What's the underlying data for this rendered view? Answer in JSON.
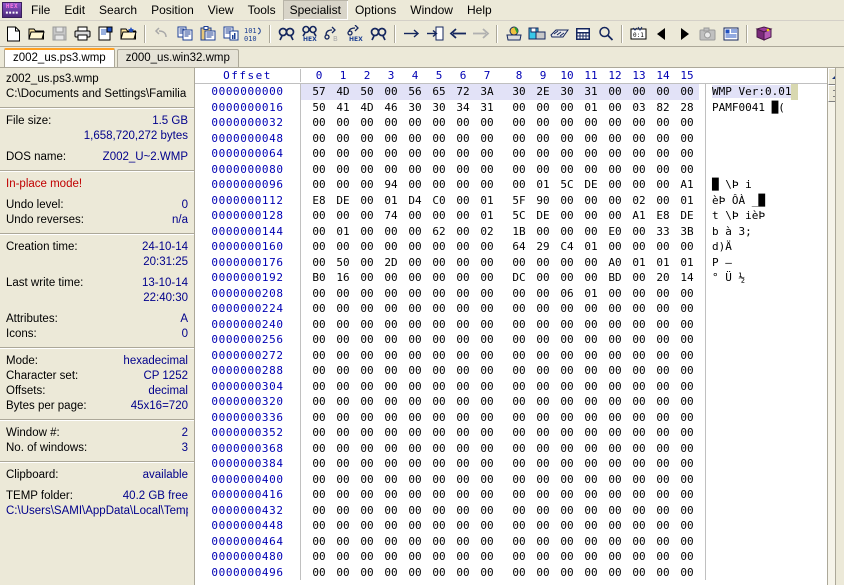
{
  "app": {
    "logo_top": "HEX",
    "logo_bottom": "Editor"
  },
  "menu": {
    "items": [
      {
        "label": "File",
        "active": false
      },
      {
        "label": "Edit",
        "active": false
      },
      {
        "label": "Search",
        "active": false
      },
      {
        "label": "Position",
        "active": false
      },
      {
        "label": "View",
        "active": false
      },
      {
        "label": "Tools",
        "active": false
      },
      {
        "label": "Specialist",
        "active": true
      },
      {
        "label": "Options",
        "active": false
      },
      {
        "label": "Window",
        "active": false
      },
      {
        "label": "Help",
        "active": false
      }
    ]
  },
  "toolbar": {
    "buttons": [
      {
        "icon": "new-file-icon",
        "enabled": true
      },
      {
        "icon": "open-folder-icon",
        "enabled": true
      },
      {
        "icon": "save-icon",
        "enabled": false
      },
      {
        "icon": "print-icon",
        "enabled": true
      },
      {
        "icon": "file-properties-icon",
        "enabled": true
      },
      {
        "icon": "open-folder-star-icon",
        "enabled": true
      },
      {
        "icon": "separator",
        "enabled": false
      },
      {
        "icon": "undo-icon",
        "enabled": false
      },
      {
        "icon": "copy-icon",
        "enabled": true
      },
      {
        "icon": "paste-icon",
        "enabled": true
      },
      {
        "icon": "clipboard-data-icon",
        "enabled": true
      },
      {
        "icon": "binary-101-icon",
        "enabled": true
      },
      {
        "icon": "separator",
        "enabled": false
      },
      {
        "icon": "find-text-icon",
        "enabled": true
      },
      {
        "icon": "find-hex-icon",
        "enabled": true
      },
      {
        "icon": "replace-text-icon",
        "enabled": true
      },
      {
        "icon": "replace-hex-icon",
        "enabled": true
      },
      {
        "icon": "find-again-icon",
        "enabled": true
      },
      {
        "icon": "separator",
        "enabled": false
      },
      {
        "icon": "goto-offset-icon",
        "enabled": true
      },
      {
        "icon": "goto-marker-icon",
        "enabled": true
      },
      {
        "icon": "back-arrow-icon",
        "enabled": true
      },
      {
        "icon": "forward-arrow-icon",
        "enabled": false
      },
      {
        "icon": "separator",
        "enabled": false
      },
      {
        "icon": "open-disk-icon",
        "enabled": true
      },
      {
        "icon": "open-drive-icon",
        "enabled": true
      },
      {
        "icon": "open-ram-icon",
        "enabled": true
      },
      {
        "icon": "calculator-icon",
        "enabled": true
      },
      {
        "icon": "analyze-icon",
        "enabled": true
      },
      {
        "icon": "separator",
        "enabled": false
      },
      {
        "icon": "calc-converter-icon",
        "enabled": true
      },
      {
        "icon": "prev-page-icon",
        "enabled": true
      },
      {
        "icon": "next-page-icon",
        "enabled": true
      },
      {
        "icon": "snapshot-icon",
        "enabled": false
      },
      {
        "icon": "report-icon",
        "enabled": true
      },
      {
        "icon": "separator",
        "enabled": false
      },
      {
        "icon": "help-book-icon",
        "enabled": true
      }
    ]
  },
  "tabs": [
    {
      "label": "z002_us.ps3.wmp",
      "active": true
    },
    {
      "label": "z000_us.win32.wmp",
      "active": false
    }
  ],
  "info_pane": {
    "file_name": "z002_us.ps3.wmp",
    "file_path": "C:\\Documents and Settings\\Familia Riv",
    "file_size_label": "File size:",
    "file_size_value": "1.5 GB",
    "file_size_bytes": "1,658,720,272 bytes",
    "dos_name_label": "DOS name:",
    "dos_name_value": "Z002_U~2.WMP",
    "mode_alert": "In-place mode!",
    "undo_level_label": "Undo level:",
    "undo_level_value": "0",
    "undo_reverses_label": "Undo reverses:",
    "undo_reverses_value": "n/a",
    "creation_time_label": "Creation time:",
    "creation_date_value": "24-10-14",
    "creation_clock_value": "20:31:25",
    "last_write_label": "Last write time:",
    "last_write_date_value": "13-10-14",
    "last_write_clock_value": "22:40:30",
    "attributes_label": "Attributes:",
    "attributes_value": "A",
    "icons_label": "Icons:",
    "icons_value": "0",
    "mode_label": "Mode:",
    "mode_value": "hexadecimal",
    "charset_label": "Character set:",
    "charset_value": "CP 1252",
    "offsets_label": "Offsets:",
    "offsets_value": "decimal",
    "bytes_per_page_label": "Bytes per page:",
    "bytes_per_page_value": "45x16=720",
    "window_num_label": "Window #:",
    "window_num_value": "2",
    "num_windows_label": "No. of windows:",
    "num_windows_value": "3",
    "clipboard_label": "Clipboard:",
    "clipboard_value": "available",
    "temp_folder_label": "TEMP folder:",
    "temp_folder_value": "40.2 GB free",
    "temp_folder_path": "C:\\Users\\SAMI\\AppData\\Local\\Temp"
  },
  "hex_view": {
    "offset_header": "Offset",
    "column_headers": [
      "0",
      "1",
      "2",
      "3",
      "4",
      "5",
      "6",
      "7",
      "8",
      "9",
      "10",
      "11",
      "12",
      "13",
      "14",
      "15"
    ],
    "rows": [
      {
        "offset": "0000000000",
        "bytes": [
          "57",
          "4D",
          "50",
          "00",
          "56",
          "65",
          "72",
          "3A",
          "30",
          "2E",
          "30",
          "31",
          "00",
          "00",
          "00",
          "00"
        ],
        "ascii": "WMP Ver:0.01",
        "selected": true,
        "caret": true
      },
      {
        "offset": "0000000016",
        "bytes": [
          "50",
          "41",
          "4D",
          "46",
          "30",
          "30",
          "34",
          "31",
          "00",
          "00",
          "00",
          "01",
          "00",
          "03",
          "82",
          "28"
        ],
        "ascii": "PAMF0041     █(",
        "selected": false,
        "caret": false
      },
      {
        "offset": "0000000032",
        "bytes": [
          "00",
          "00",
          "00",
          "00",
          "00",
          "00",
          "00",
          "00",
          "00",
          "00",
          "00",
          "00",
          "00",
          "00",
          "00",
          "00"
        ],
        "ascii": "",
        "selected": false,
        "caret": false
      },
      {
        "offset": "0000000048",
        "bytes": [
          "00",
          "00",
          "00",
          "00",
          "00",
          "00",
          "00",
          "00",
          "00",
          "00",
          "00",
          "00",
          "00",
          "00",
          "00",
          "00"
        ],
        "ascii": "",
        "selected": false,
        "caret": false
      },
      {
        "offset": "0000000064",
        "bytes": [
          "00",
          "00",
          "00",
          "00",
          "00",
          "00",
          "00",
          "00",
          "00",
          "00",
          "00",
          "00",
          "00",
          "00",
          "00",
          "00"
        ],
        "ascii": "",
        "selected": false,
        "caret": false
      },
      {
        "offset": "0000000080",
        "bytes": [
          "00",
          "00",
          "00",
          "00",
          "00",
          "00",
          "00",
          "00",
          "00",
          "00",
          "00",
          "00",
          "00",
          "00",
          "00",
          "00"
        ],
        "ascii": "",
        "selected": false,
        "caret": false
      },
      {
        "offset": "0000000096",
        "bytes": [
          "00",
          "00",
          "00",
          "94",
          "00",
          "00",
          "00",
          "00",
          "00",
          "01",
          "5C",
          "DE",
          "00",
          "00",
          "00",
          "A1"
        ],
        "ascii": "   █       \\Þ   i",
        "selected": false,
        "caret": false
      },
      {
        "offset": "0000000112",
        "bytes": [
          "E8",
          "DE",
          "00",
          "01",
          "D4",
          "C0",
          "00",
          "01",
          "5F",
          "90",
          "00",
          "00",
          "00",
          "02",
          "00",
          "01"
        ],
        "ascii": "èÞ  ÔÀ  _█",
        "selected": false,
        "caret": false
      },
      {
        "offset": "0000000128",
        "bytes": [
          "00",
          "00",
          "00",
          "74",
          "00",
          "00",
          "00",
          "01",
          "5C",
          "DE",
          "00",
          "00",
          "00",
          "A1",
          "E8",
          "DE"
        ],
        "ascii": "   t    \\Þ   ièÞ",
        "selected": false,
        "caret": false
      },
      {
        "offset": "0000000144",
        "bytes": [
          "00",
          "01",
          "00",
          "00",
          "00",
          "62",
          "00",
          "02",
          "1B",
          "00",
          "00",
          "00",
          "E0",
          "00",
          "33",
          "3B"
        ],
        "ascii": "     b      à 3;",
        "selected": false,
        "caret": false
      },
      {
        "offset": "0000000160",
        "bytes": [
          "00",
          "00",
          "00",
          "00",
          "00",
          "00",
          "00",
          "00",
          "64",
          "29",
          "C4",
          "01",
          "00",
          "00",
          "00",
          "00"
        ],
        "ascii": "        d)Ä",
        "selected": false,
        "caret": false
      },
      {
        "offset": "0000000176",
        "bytes": [
          "00",
          "50",
          "00",
          "2D",
          "00",
          "00",
          "00",
          "00",
          "00",
          "00",
          "00",
          "00",
          "A0",
          "01",
          "01",
          "01"
        ],
        "ascii": " P –",
        "selected": false,
        "caret": false
      },
      {
        "offset": "0000000192",
        "bytes": [
          "B0",
          "16",
          "00",
          "00",
          "00",
          "00",
          "00",
          "00",
          "DC",
          "00",
          "00",
          "00",
          "BD",
          "00",
          "20",
          "14"
        ],
        "ascii": "°       Ü   ½",
        "selected": false,
        "caret": false
      },
      {
        "offset": "0000000208",
        "bytes": [
          "00",
          "00",
          "00",
          "00",
          "00",
          "00",
          "00",
          "00",
          "00",
          "00",
          "06",
          "01",
          "00",
          "00",
          "00",
          "00"
        ],
        "ascii": "",
        "selected": false,
        "caret": false
      },
      {
        "offset": "0000000224",
        "bytes": [
          "00",
          "00",
          "00",
          "00",
          "00",
          "00",
          "00",
          "00",
          "00",
          "00",
          "00",
          "00",
          "00",
          "00",
          "00",
          "00"
        ],
        "ascii": "",
        "selected": false,
        "caret": false
      },
      {
        "offset": "0000000240",
        "bytes": [
          "00",
          "00",
          "00",
          "00",
          "00",
          "00",
          "00",
          "00",
          "00",
          "00",
          "00",
          "00",
          "00",
          "00",
          "00",
          "00"
        ],
        "ascii": "",
        "selected": false,
        "caret": false
      },
      {
        "offset": "0000000256",
        "bytes": [
          "00",
          "00",
          "00",
          "00",
          "00",
          "00",
          "00",
          "00",
          "00",
          "00",
          "00",
          "00",
          "00",
          "00",
          "00",
          "00"
        ],
        "ascii": "",
        "selected": false,
        "caret": false
      },
      {
        "offset": "0000000272",
        "bytes": [
          "00",
          "00",
          "00",
          "00",
          "00",
          "00",
          "00",
          "00",
          "00",
          "00",
          "00",
          "00",
          "00",
          "00",
          "00",
          "00"
        ],
        "ascii": "",
        "selected": false,
        "caret": false
      },
      {
        "offset": "0000000288",
        "bytes": [
          "00",
          "00",
          "00",
          "00",
          "00",
          "00",
          "00",
          "00",
          "00",
          "00",
          "00",
          "00",
          "00",
          "00",
          "00",
          "00"
        ],
        "ascii": "",
        "selected": false,
        "caret": false
      },
      {
        "offset": "0000000304",
        "bytes": [
          "00",
          "00",
          "00",
          "00",
          "00",
          "00",
          "00",
          "00",
          "00",
          "00",
          "00",
          "00",
          "00",
          "00",
          "00",
          "00"
        ],
        "ascii": "",
        "selected": false,
        "caret": false
      },
      {
        "offset": "0000000320",
        "bytes": [
          "00",
          "00",
          "00",
          "00",
          "00",
          "00",
          "00",
          "00",
          "00",
          "00",
          "00",
          "00",
          "00",
          "00",
          "00",
          "00"
        ],
        "ascii": "",
        "selected": false,
        "caret": false
      },
      {
        "offset": "0000000336",
        "bytes": [
          "00",
          "00",
          "00",
          "00",
          "00",
          "00",
          "00",
          "00",
          "00",
          "00",
          "00",
          "00",
          "00",
          "00",
          "00",
          "00"
        ],
        "ascii": "",
        "selected": false,
        "caret": false
      },
      {
        "offset": "0000000352",
        "bytes": [
          "00",
          "00",
          "00",
          "00",
          "00",
          "00",
          "00",
          "00",
          "00",
          "00",
          "00",
          "00",
          "00",
          "00",
          "00",
          "00"
        ],
        "ascii": "",
        "selected": false,
        "caret": false
      },
      {
        "offset": "0000000368",
        "bytes": [
          "00",
          "00",
          "00",
          "00",
          "00",
          "00",
          "00",
          "00",
          "00",
          "00",
          "00",
          "00",
          "00",
          "00",
          "00",
          "00"
        ],
        "ascii": "",
        "selected": false,
        "caret": false
      },
      {
        "offset": "0000000384",
        "bytes": [
          "00",
          "00",
          "00",
          "00",
          "00",
          "00",
          "00",
          "00",
          "00",
          "00",
          "00",
          "00",
          "00",
          "00",
          "00",
          "00"
        ],
        "ascii": "",
        "selected": false,
        "caret": false
      },
      {
        "offset": "0000000400",
        "bytes": [
          "00",
          "00",
          "00",
          "00",
          "00",
          "00",
          "00",
          "00",
          "00",
          "00",
          "00",
          "00",
          "00",
          "00",
          "00",
          "00"
        ],
        "ascii": "",
        "selected": false,
        "caret": false
      },
      {
        "offset": "0000000416",
        "bytes": [
          "00",
          "00",
          "00",
          "00",
          "00",
          "00",
          "00",
          "00",
          "00",
          "00",
          "00",
          "00",
          "00",
          "00",
          "00",
          "00"
        ],
        "ascii": "",
        "selected": false,
        "caret": false
      },
      {
        "offset": "0000000432",
        "bytes": [
          "00",
          "00",
          "00",
          "00",
          "00",
          "00",
          "00",
          "00",
          "00",
          "00",
          "00",
          "00",
          "00",
          "00",
          "00",
          "00"
        ],
        "ascii": "",
        "selected": false,
        "caret": false
      },
      {
        "offset": "0000000448",
        "bytes": [
          "00",
          "00",
          "00",
          "00",
          "00",
          "00",
          "00",
          "00",
          "00",
          "00",
          "00",
          "00",
          "00",
          "00",
          "00",
          "00"
        ],
        "ascii": "",
        "selected": false,
        "caret": false
      },
      {
        "offset": "0000000464",
        "bytes": [
          "00",
          "00",
          "00",
          "00",
          "00",
          "00",
          "00",
          "00",
          "00",
          "00",
          "00",
          "00",
          "00",
          "00",
          "00",
          "00"
        ],
        "ascii": "",
        "selected": false,
        "caret": false
      },
      {
        "offset": "0000000480",
        "bytes": [
          "00",
          "00",
          "00",
          "00",
          "00",
          "00",
          "00",
          "00",
          "00",
          "00",
          "00",
          "00",
          "00",
          "00",
          "00",
          "00"
        ],
        "ascii": "",
        "selected": false,
        "caret": false
      },
      {
        "offset": "0000000496",
        "bytes": [
          "00",
          "00",
          "00",
          "00",
          "00",
          "00",
          "00",
          "00",
          "00",
          "00",
          "00",
          "00",
          "00",
          "00",
          "00",
          "00"
        ],
        "ascii": "",
        "selected": false,
        "caret": false
      }
    ]
  },
  "colors": {
    "offset_blue": "#0000b4",
    "value_blue": "#00008b",
    "alert_red": "#c00000",
    "selection": "#e2e2f7",
    "caret": "#d8d8b0",
    "tab_accent": "#ffa022",
    "chrome": "#ece9d8"
  }
}
